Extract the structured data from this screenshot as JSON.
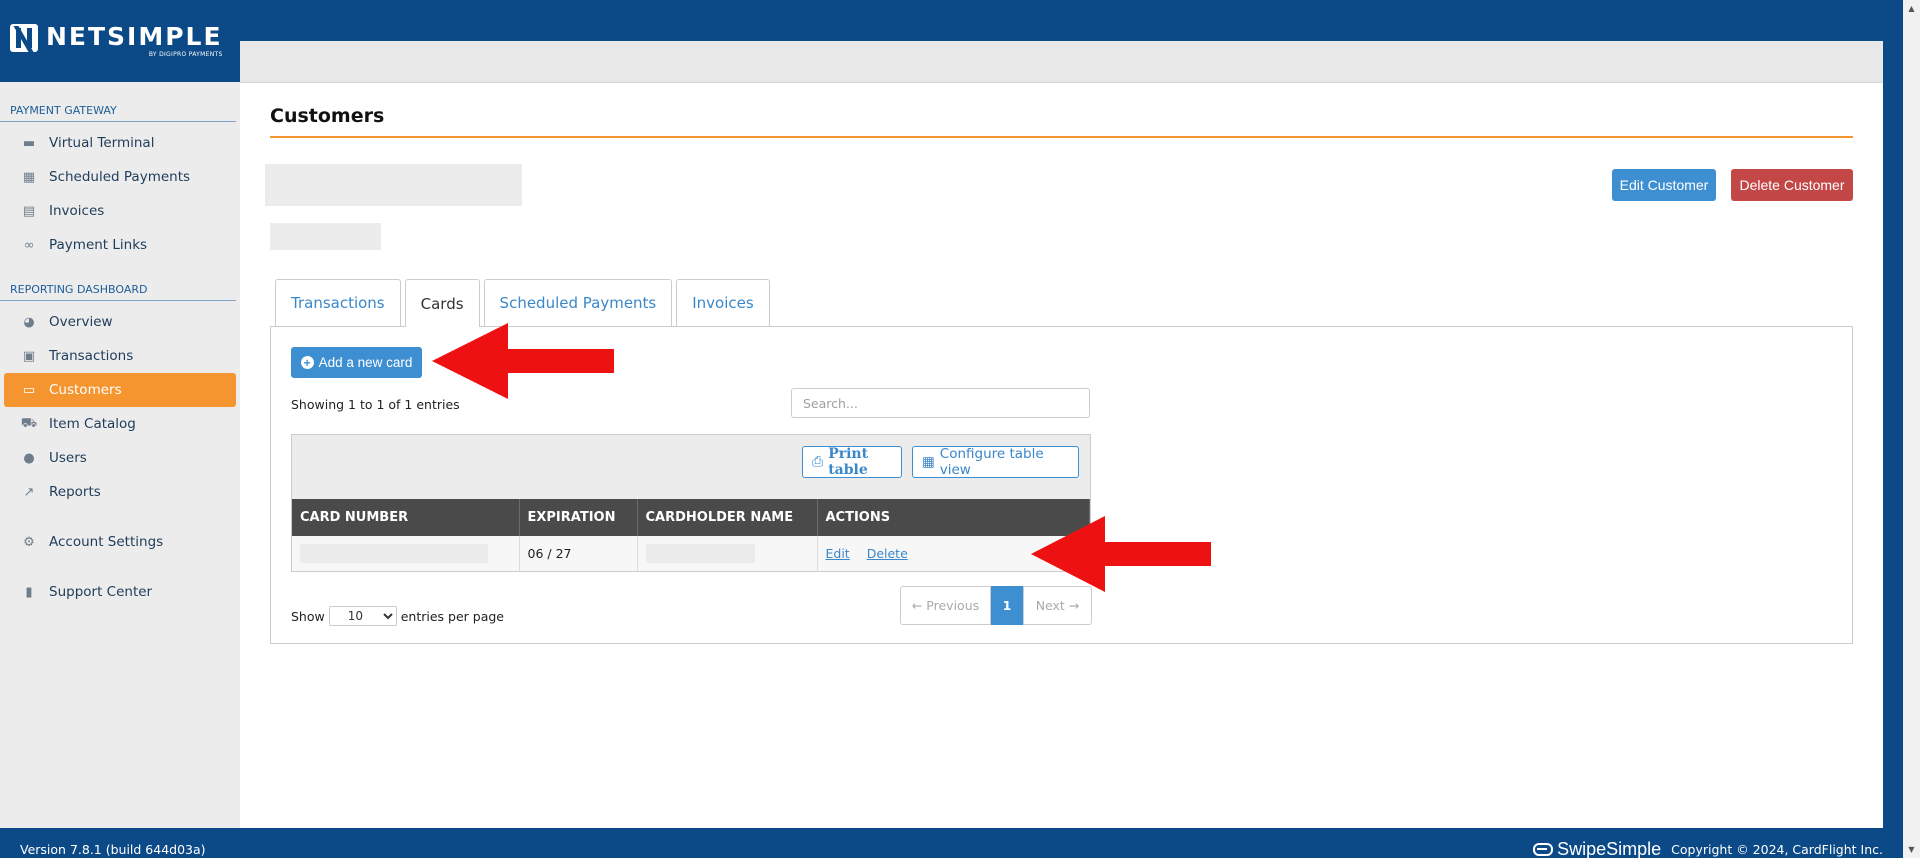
{
  "brand": {
    "logo_text": "NETSIMPLE",
    "logo_sub": "BY DIGIPRO PAYMENTS"
  },
  "sidebar": {
    "sections": [
      {
        "title": "PAYMENT GATEWAY"
      },
      {
        "title": "REPORTING DASHBOARD"
      }
    ],
    "items": [
      {
        "label": "Virtual Terminal",
        "icon": "credit-card-icon"
      },
      {
        "label": "Scheduled Payments",
        "icon": "calendar-icon"
      },
      {
        "label": "Invoices",
        "icon": "invoice-icon"
      },
      {
        "label": "Payment Links",
        "icon": "link-icon"
      },
      {
        "label": "Overview",
        "icon": "dashboard-icon"
      },
      {
        "label": "Transactions",
        "icon": "money-icon"
      },
      {
        "label": "Customers",
        "icon": "id-card-icon",
        "active": true
      },
      {
        "label": "Item Catalog",
        "icon": "cart-icon"
      },
      {
        "label": "Users",
        "icon": "users-icon"
      },
      {
        "label": "Reports",
        "icon": "chart-line-icon"
      },
      {
        "label": "Account Settings",
        "icon": "gear-icon"
      },
      {
        "label": "Support Center",
        "icon": "book-icon"
      }
    ]
  },
  "page": {
    "title": "Customers",
    "edit_customer": "Edit Customer",
    "delete_customer": "Delete Customer"
  },
  "tabs": [
    {
      "label": "Transactions",
      "active": false
    },
    {
      "label": "Cards",
      "active": true
    },
    {
      "label": "Scheduled Payments",
      "active": false
    },
    {
      "label": "Invoices",
      "active": false
    }
  ],
  "cards": {
    "add_button": "Add a new card",
    "showing": "Showing 1 to 1 of 1 entries",
    "search_placeholder": "Search...",
    "print_table": "Print table",
    "configure_table": "Configure table view",
    "columns": [
      "CARD NUMBER",
      "EXPIRATION",
      "CARDHOLDER NAME",
      "ACTIONS"
    ],
    "rows": [
      {
        "expiration": "06 / 27",
        "edit": "Edit",
        "delete": "Delete"
      }
    ],
    "show_label": "Show",
    "per_page_value": "10",
    "per_page_suffix": "entries per page",
    "pager": {
      "prev": "← Previous",
      "page": "1",
      "next": "Next →"
    }
  },
  "footer": {
    "version": "Version 7.8.1 (build 644d03a)",
    "swipe_logo": "SwipeSimple",
    "copyright": "Copyright © 2024, CardFlight Inc."
  },
  "colors": {
    "brand_blue": "#0b4a87",
    "accent_orange": "#f5952f",
    "primary_button": "#3d8fd1",
    "danger_button": "#c44747",
    "annotation_arrow": "#ee1111"
  }
}
